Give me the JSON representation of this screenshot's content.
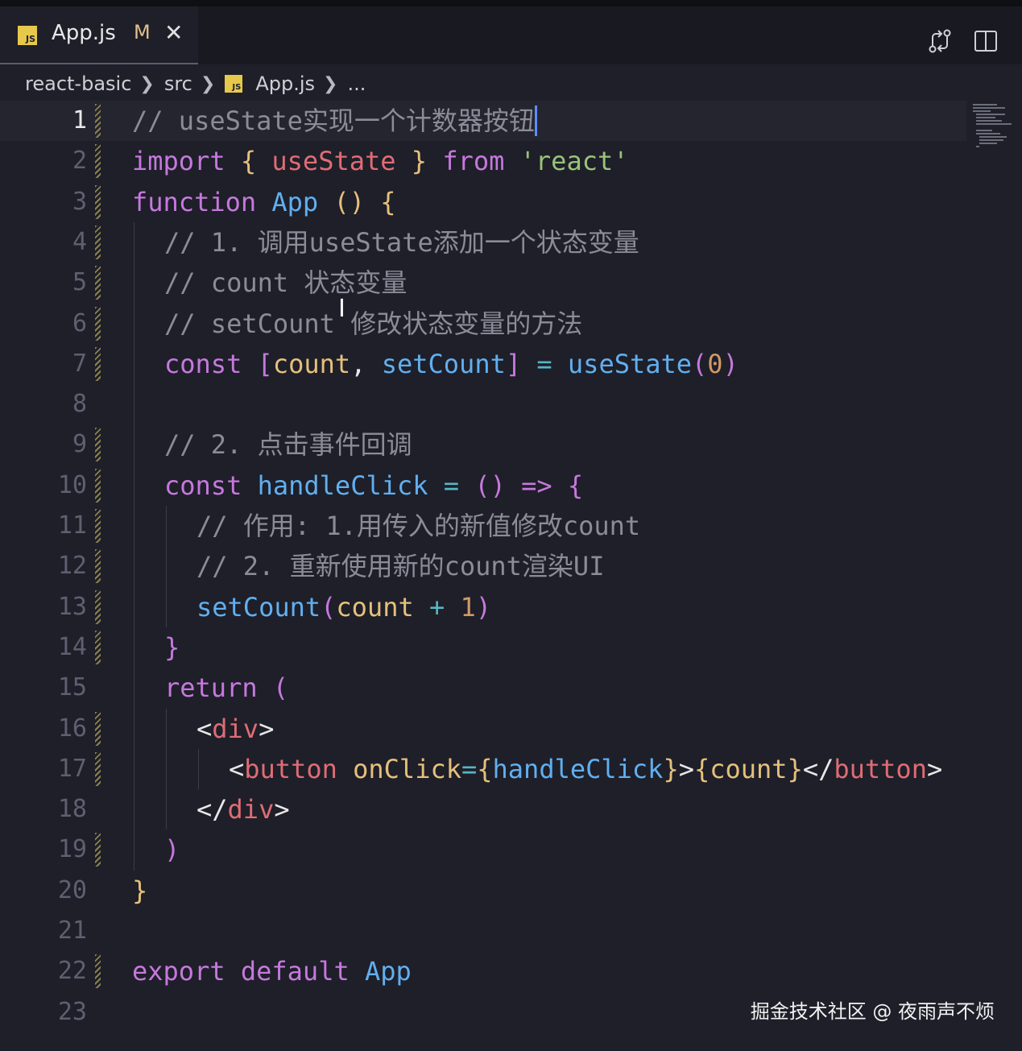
{
  "tab": {
    "icon": "javascript-file-icon",
    "badge": "JS",
    "title": "App.js",
    "status": "M",
    "close": "✕"
  },
  "toolbar": {
    "icons": [
      "git-compare-icon",
      "split-editor-icon"
    ]
  },
  "breadcrumb": {
    "items": [
      "react-basic",
      "src",
      "App.js",
      "..."
    ],
    "badge": "JS"
  },
  "editor": {
    "active_line": 1,
    "lines": [
      {
        "n": "1",
        "tokens": [
          {
            "t": "// useState实现一个计数器按钮",
            "c": "cmt"
          }
        ],
        "modified": true
      },
      {
        "n": "2",
        "tokens": [
          {
            "t": "import",
            "c": "kw"
          },
          {
            "t": " "
          },
          {
            "t": "{",
            "c": "brc"
          },
          {
            "t": " "
          },
          {
            "t": "useState",
            "c": "tag"
          },
          {
            "t": " "
          },
          {
            "t": "}",
            "c": "brc"
          },
          {
            "t": " "
          },
          {
            "t": "from",
            "c": "kw"
          },
          {
            "t": " "
          },
          {
            "t": "'react'",
            "c": "str"
          }
        ],
        "modified": true
      },
      {
        "n": "3",
        "tokens": [
          {
            "t": "function",
            "c": "kw"
          },
          {
            "t": " "
          },
          {
            "t": "App",
            "c": "fn"
          },
          {
            "t": " "
          },
          {
            "t": "()",
            "c": "brc"
          },
          {
            "t": " "
          },
          {
            "t": "{",
            "c": "brc"
          }
        ],
        "modified": true
      },
      {
        "n": "4",
        "indent": 1,
        "tokens": [
          {
            "t": "// 1. 调用useState添加一个状态变量",
            "c": "cmt"
          }
        ],
        "modified": true
      },
      {
        "n": "5",
        "indent": 1,
        "tokens": [
          {
            "t": "// count 状态变量",
            "c": "cmt"
          }
        ],
        "modified": true
      },
      {
        "n": "6",
        "indent": 1,
        "tokens": [
          {
            "t": "// setCount 修改状态变量的方法",
            "c": "cmt"
          }
        ],
        "modified": true
      },
      {
        "n": "7",
        "indent": 1,
        "tokens": [
          {
            "t": "const",
            "c": "kw"
          },
          {
            "t": " "
          },
          {
            "t": "[",
            "c": "kw"
          },
          {
            "t": "count",
            "c": "var"
          },
          {
            "t": ", "
          },
          {
            "t": "setCount",
            "c": "fn"
          },
          {
            "t": "]",
            "c": "kw"
          },
          {
            "t": " "
          },
          {
            "t": "=",
            "c": "op"
          },
          {
            "t": " "
          },
          {
            "t": "useState",
            "c": "fn"
          },
          {
            "t": "(",
            "c": "kw"
          },
          {
            "t": "0",
            "c": "num"
          },
          {
            "t": ")",
            "c": "kw"
          }
        ],
        "modified": true
      },
      {
        "n": "8",
        "tokens": [],
        "modified": false
      },
      {
        "n": "9",
        "indent": 1,
        "tokens": [
          {
            "t": "// 2. 点击事件回调",
            "c": "cmt"
          }
        ],
        "modified": true
      },
      {
        "n": "10",
        "indent": 1,
        "tokens": [
          {
            "t": "const",
            "c": "kw"
          },
          {
            "t": " "
          },
          {
            "t": "handleClick",
            "c": "fn"
          },
          {
            "t": " "
          },
          {
            "t": "=",
            "c": "op"
          },
          {
            "t": " "
          },
          {
            "t": "()",
            "c": "kw"
          },
          {
            "t": " "
          },
          {
            "t": "=>",
            "c": "kw"
          },
          {
            "t": " "
          },
          {
            "t": "{",
            "c": "kw"
          }
        ],
        "modified": true
      },
      {
        "n": "11",
        "indent": 2,
        "tokens": [
          {
            "t": "// 作用: 1.用传入的新值修改count",
            "c": "cmt"
          }
        ],
        "modified": true
      },
      {
        "n": "12",
        "indent": 2,
        "tokens": [
          {
            "t": "// 2. 重新使用新的count渲染UI",
            "c": "cmt"
          }
        ],
        "modified": true
      },
      {
        "n": "13",
        "indent": 2,
        "tokens": [
          {
            "t": "setCount",
            "c": "fn"
          },
          {
            "t": "(",
            "c": "kw"
          },
          {
            "t": "count",
            "c": "var"
          },
          {
            "t": " "
          },
          {
            "t": "+",
            "c": "op"
          },
          {
            "t": " "
          },
          {
            "t": "1",
            "c": "num"
          },
          {
            "t": ")",
            "c": "kw"
          }
        ],
        "modified": true
      },
      {
        "n": "14",
        "indent": 1,
        "tokens": [
          {
            "t": "}",
            "c": "kw"
          }
        ],
        "modified": true
      },
      {
        "n": "15",
        "indent": 1,
        "tokens": [
          {
            "t": "return",
            "c": "kw"
          },
          {
            "t": " "
          },
          {
            "t": "(",
            "c": "kw"
          }
        ],
        "modified": false
      },
      {
        "n": "16",
        "indent": 2,
        "tokens": [
          {
            "t": "<"
          },
          {
            "t": "div",
            "c": "tag"
          },
          {
            "t": ">"
          }
        ],
        "modified": true
      },
      {
        "n": "17",
        "indent": 3,
        "tokens": [
          {
            "t": "<"
          },
          {
            "t": "button",
            "c": "tag"
          },
          {
            "t": " "
          },
          {
            "t": "onClick",
            "c": "var"
          },
          {
            "t": "=",
            "c": "op"
          },
          {
            "t": "{",
            "c": "var"
          },
          {
            "t": "handleClick",
            "c": "fn"
          },
          {
            "t": "}",
            "c": "var"
          },
          {
            "t": ">"
          },
          {
            "t": "{",
            "c": "var"
          },
          {
            "t": "count",
            "c": "var"
          },
          {
            "t": "}",
            "c": "var"
          },
          {
            "t": "</"
          },
          {
            "t": "button",
            "c": "tag"
          },
          {
            "t": ">"
          }
        ],
        "modified": true
      },
      {
        "n": "18",
        "indent": 2,
        "tokens": [
          {
            "t": "</"
          },
          {
            "t": "div",
            "c": "tag"
          },
          {
            "t": ">"
          }
        ],
        "modified": false
      },
      {
        "n": "19",
        "indent": 1,
        "tokens": [
          {
            "t": ")",
            "c": "kw"
          }
        ],
        "modified": true
      },
      {
        "n": "20",
        "tokens": [
          {
            "t": "}",
            "c": "brc"
          }
        ],
        "modified": false
      },
      {
        "n": "21",
        "tokens": [],
        "modified": false
      },
      {
        "n": "22",
        "tokens": [
          {
            "t": "export",
            "c": "kw"
          },
          {
            "t": " "
          },
          {
            "t": "default",
            "c": "kw"
          },
          {
            "t": " "
          },
          {
            "t": "App",
            "c": "fn"
          }
        ],
        "modified": true
      },
      {
        "n": "23",
        "tokens": [],
        "modified": false
      }
    ]
  },
  "watermark": "掘金技术社区 @ 夜雨声不烦"
}
